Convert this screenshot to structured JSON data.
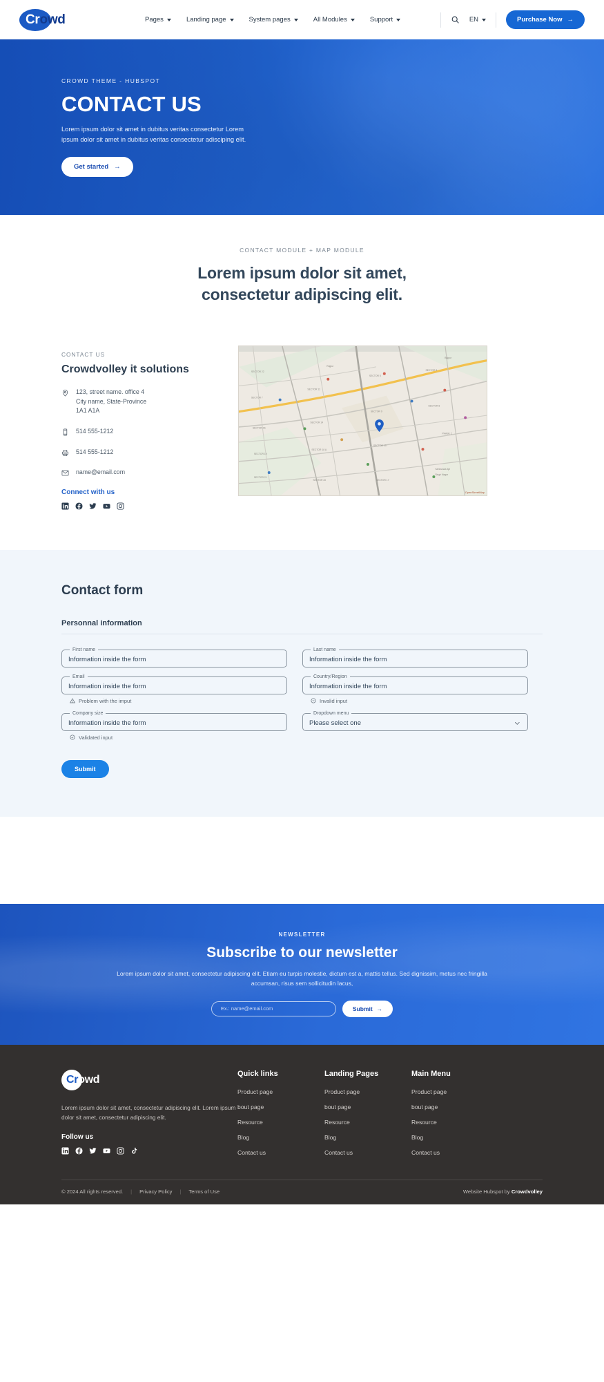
{
  "header": {
    "logo": {
      "part1": "Cr",
      "part2": "owd",
      "full": "Crowd"
    },
    "nav": [
      {
        "label": "Pages"
      },
      {
        "label": "Landing page"
      },
      {
        "label": "System pages"
      },
      {
        "label": "All Modules"
      },
      {
        "label": "Support"
      }
    ],
    "language": "EN",
    "purchase_label": "Purchase Now",
    "purchase_arrow": "→"
  },
  "hero": {
    "kicker": "CROWD THEME - HUBSPOT",
    "title": "CONTACT US",
    "subtitle": "Lorem ipsum dolor sit amet in dubitus veritas consectetur Lorem ipsum dolor sit amet in dubitus veritas consectetur adisciping elit.",
    "cta_label": "Get started",
    "cta_arrow": "→"
  },
  "contact_section": {
    "kicker": "CONTACT MODULE + MAP MODULE",
    "title_line1": "Lorem ipsum dolor sit amet,",
    "title_line2": "consectetur adipiscing elit.",
    "info": {
      "kicker": "CONTACT US",
      "company": "Crowdvolley it solutions",
      "address_line1": "123, street name. office 4",
      "address_line2": "City name, State-Province",
      "address_line3": "1A1 A1A",
      "phone": "514 555-1212",
      "fax": "514 555-1212",
      "email": "name@email.com",
      "connect_label": "Connect with us",
      "socials": [
        "linkedin-icon",
        "facebook-icon",
        "twitter-icon",
        "youtube-icon",
        "instagram-icon"
      ]
    },
    "map": {
      "attribution": "OpenStreetMap"
    }
  },
  "form": {
    "title": "Contact form",
    "subtitle": "Personnal information",
    "fields": [
      {
        "label": "First name",
        "value": "Information inside the form",
        "help": "",
        "help_icon": ""
      },
      {
        "label": "Last name",
        "value": "Information inside the form",
        "help": "",
        "help_icon": ""
      },
      {
        "label": "Email",
        "value": "Information inside the form",
        "help": "Problem with the imput",
        "help_icon": "warning-icon"
      },
      {
        "label": "Country/Region",
        "value": "Information inside the form",
        "help": "Invalid input",
        "help_icon": "error-icon"
      },
      {
        "label": "Company size",
        "value": "Information inside the form",
        "help": "Validated input",
        "help_icon": "check-icon"
      },
      {
        "label": "Dropdown menu",
        "value": "Please select one",
        "help": "",
        "help_icon": "",
        "is_select": true
      }
    ],
    "submit_label": "Submit"
  },
  "newsletter": {
    "kicker": "NEWSLETTER",
    "title": "Subscribe to our newsletter",
    "subtitle": "Lorem ipsum dolor sit amet, consectetur adipiscing elit. Etiam eu turpis molestie, dictum est a, mattis tellus. Sed dignissim, metus nec fringilla accumsan, risus sem sollicitudin lacus,",
    "input_placeholder": "Ex.: name@email.com",
    "submit_label": "Submit",
    "submit_arrow": "→"
  },
  "footer": {
    "logo": {
      "part1": "Cr",
      "part2": "owd"
    },
    "about": "Lorem ipsum dolor sit amet, consectetur adipiscing elit. Lorem ipsum dolor sit amet, consectetur adipiscing elit.",
    "follow_label": "Follow us",
    "socials": [
      "linkedin-icon",
      "facebook-icon",
      "twitter-icon",
      "youtube-icon",
      "instagram-icon",
      "tiktok-icon"
    ],
    "columns": [
      {
        "title": "Quick links",
        "links": [
          "Product page",
          "bout page",
          "Resource",
          "Blog",
          "Contact us"
        ]
      },
      {
        "title": "Landing Pages",
        "links": [
          "Product page",
          "bout page",
          "Resource",
          "Blog",
          "Contact us"
        ]
      },
      {
        "title": "Main Menu",
        "links": [
          "Product page",
          "bout page",
          "Resource",
          "Blog",
          "Contact us"
        ]
      }
    ],
    "copyright": "© 2024 All rights reserved.",
    "privacy": "Privacy Policy",
    "terms": "Terms of Use",
    "credit_prefix": "Website Hubspot by ",
    "credit_brand": "Crowdvolley"
  },
  "colors": {
    "brand_blue": "#1667d4",
    "hero_blue": "#2563cf",
    "form_bg": "#f1f6fb",
    "footer_bg": "#33302f"
  }
}
